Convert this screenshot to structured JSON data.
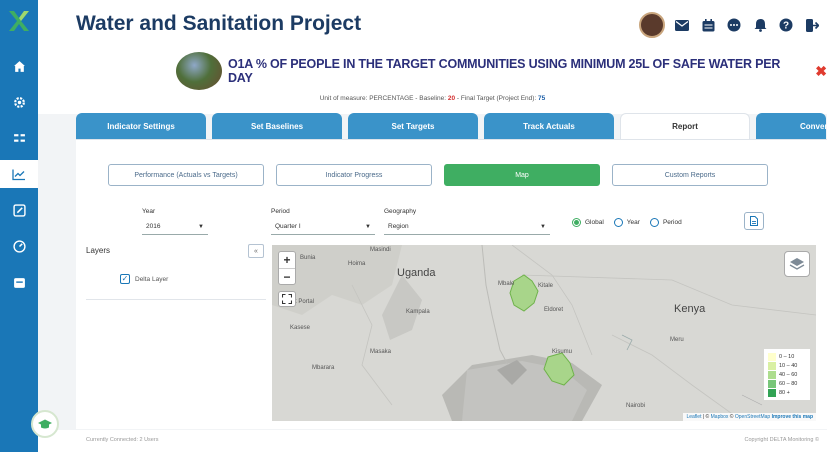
{
  "header": {
    "title": "Water and Sanitation Project"
  },
  "sidebar": {
    "items": [
      {
        "icon": "home-icon"
      },
      {
        "icon": "settings-icon"
      },
      {
        "icon": "list-icon"
      },
      {
        "icon": "chart-line-icon",
        "active": true
      },
      {
        "icon": "edit-icon"
      },
      {
        "icon": "dashboard-icon"
      },
      {
        "icon": "folder-icon"
      }
    ]
  },
  "indicator": {
    "title": "O1A % OF PEOPLE IN THE TARGET COMMUNITIES USING MINIMUM 25L OF SAFE WATER PER DAY",
    "uom_prefix": "Unit of measure: PERCENTAGE - Baseline:",
    "baseline": "20",
    "target_prefix": "- Final Target (Project End):",
    "final_target": "75"
  },
  "tabs": [
    {
      "label": "Indicator Settings"
    },
    {
      "label": "Set Baselines"
    },
    {
      "label": "Set Targets"
    },
    {
      "label": "Track Actuals"
    },
    {
      "label": "Report",
      "active": true
    },
    {
      "label": "Conver"
    }
  ],
  "subtabs": [
    {
      "label": "Performance (Actuals vs Targets)"
    },
    {
      "label": "Indicator Progress"
    },
    {
      "label": "Map",
      "active": true
    },
    {
      "label": "Custom Reports"
    }
  ],
  "filters": {
    "year_label": "Year",
    "year_value": "2016",
    "period_label": "Period",
    "period_value": "Quarter I",
    "geography_label": "Geography",
    "geography_value": "Region",
    "radio_global": "Global",
    "radio_year": "Year",
    "radio_period": "Period",
    "selected_radio": "Global"
  },
  "layers": {
    "title": "Layers",
    "collapse": "«",
    "items": [
      {
        "label": "Delta Layer",
        "checked": true
      }
    ]
  },
  "map": {
    "zoom_in": "+",
    "zoom_out": "−",
    "labels": {
      "uganda": "Uganda",
      "kenya": "Kenya",
      "kampala": "Kampala",
      "nairobi": "Nairobi",
      "masindi": "Masindi",
      "hoima": "Hoima",
      "fort_portal": "Fort Portal",
      "kasese": "Kasese",
      "masaka": "Masaka",
      "mbarara": "Mbarara",
      "mbale": "Mbale",
      "kitale": "Kitale",
      "eldoret": "Eldoret",
      "meru": "Meru",
      "kisumu": "Kisumu",
      "bunia": "Bunia"
    },
    "legend": [
      {
        "label": "0 – 10",
        "color": "#ffffcc"
      },
      {
        "label": "10 – 40",
        "color": "#d9f0a3"
      },
      {
        "label": "40 – 60",
        "color": "#addd8e"
      },
      {
        "label": "60 – 80",
        "color": "#78c679"
      },
      {
        "label": "80 +",
        "color": "#31a354"
      }
    ],
    "attribution": {
      "leaflet": "Leaflet",
      "sep1": " | © ",
      "mapbox": "Mapbox",
      "sep2": " © ",
      "osm": "OpenStreetMap",
      "improve": "Improve this map"
    }
  },
  "footer": {
    "left": "Currently Connected: 2 Users",
    "right": "Copyright DELTA Monitoring ©"
  },
  "colors": {
    "sidebar": "#1a77b7",
    "tab": "#3a93c9",
    "accent_green": "#3fae62",
    "title": "#1c3b63"
  }
}
